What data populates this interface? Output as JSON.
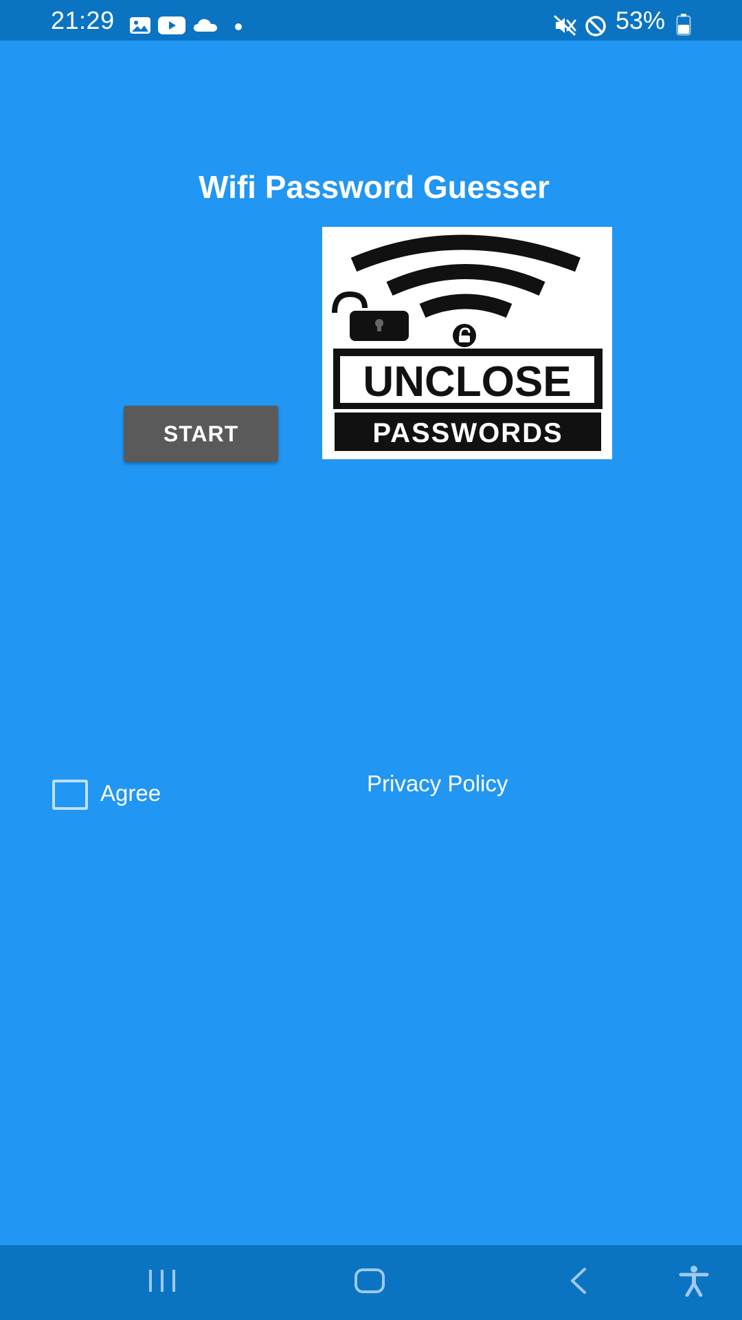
{
  "status_bar": {
    "time": "21:29",
    "battery_percent": "53%",
    "battery_level": 0.53,
    "left_icons": [
      "gallery-icon",
      "youtube-icon",
      "cloud-icon",
      "dot-icon"
    ],
    "right_icons": [
      "vibrate-mute-icon",
      "do-not-disturb-icon",
      "battery-icon"
    ]
  },
  "app": {
    "title": "Wifi Password Guesser",
    "start_label": "START",
    "logo": {
      "line1": "UNCLOSE",
      "line2": "PASSWORDS"
    },
    "agree_label": "Agree",
    "agree_checked": false,
    "privacy_label": "Privacy Policy"
  },
  "nav_bar": {
    "icons": [
      "recent-apps-icon",
      "home-icon",
      "back-icon",
      "accessibility-icon"
    ]
  },
  "colors": {
    "background": "#2196F3",
    "bars": "#0B74C2",
    "button": "#5a5a5a",
    "text": "#ffffff"
  }
}
